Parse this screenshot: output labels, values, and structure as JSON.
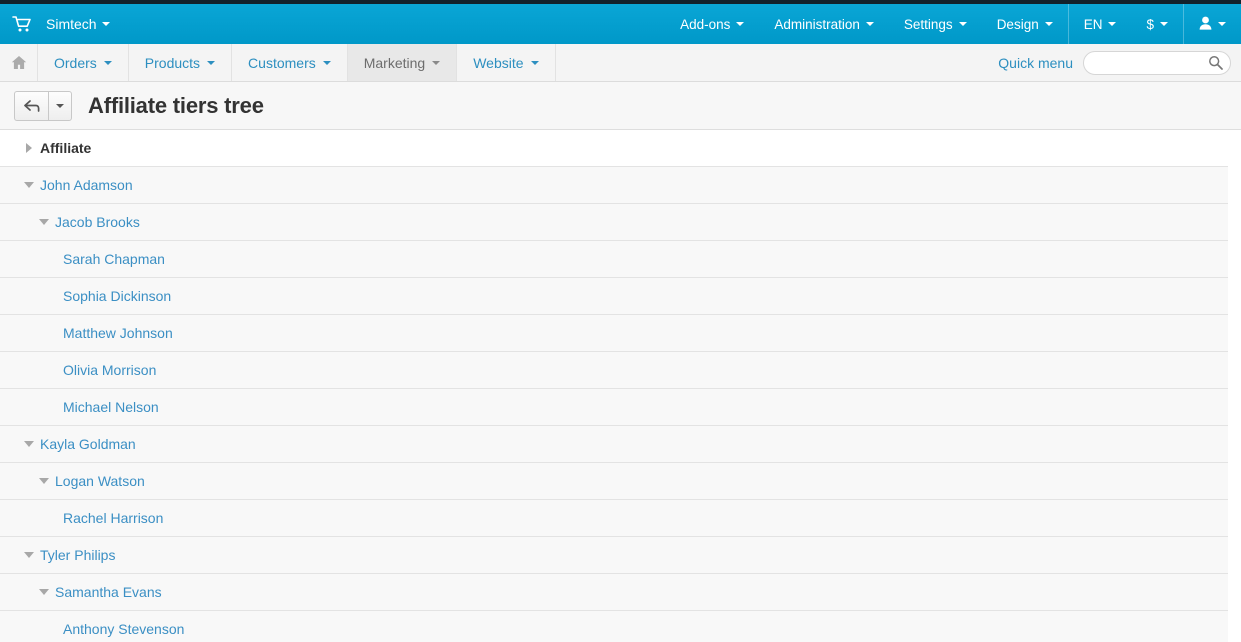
{
  "header": {
    "logo_icon": "cart-icon",
    "brand": "Simtech",
    "nav": [
      {
        "label": "Add-ons",
        "caret": true,
        "sep": false
      },
      {
        "label": "Administration",
        "caret": true,
        "sep": false
      },
      {
        "label": "Settings",
        "caret": true,
        "sep": false
      },
      {
        "label": "Design",
        "caret": true,
        "sep": false
      },
      {
        "label": "EN",
        "caret": true,
        "sep": true
      },
      {
        "label": "$",
        "caret": true,
        "sep": false
      }
    ],
    "user_icon": "user-icon"
  },
  "subnav": {
    "home_icon": "home-icon",
    "items": [
      {
        "label": "Orders",
        "active": false
      },
      {
        "label": "Products",
        "active": false
      },
      {
        "label": "Customers",
        "active": false
      },
      {
        "label": "Marketing",
        "active": true
      },
      {
        "label": "Website",
        "active": false
      }
    ],
    "quick_menu": "Quick menu",
    "search_value": "",
    "search_placeholder": ""
  },
  "titlebar": {
    "back_icon": "arrow-left-icon",
    "title": "Affiliate tiers tree"
  },
  "tree": {
    "rows": [
      {
        "label": "Affiliate",
        "level": 0,
        "toggle": "right",
        "header": true
      },
      {
        "label": "John Adamson",
        "level": 0,
        "toggle": "down",
        "header": false
      },
      {
        "label": "Jacob Brooks",
        "level": 1,
        "toggle": "down",
        "header": false
      },
      {
        "label": "Sarah Chapman",
        "level": 2,
        "toggle": "none",
        "header": false
      },
      {
        "label": "Sophia Dickinson",
        "level": 2,
        "toggle": "none",
        "header": false
      },
      {
        "label": "Matthew Johnson",
        "level": 2,
        "toggle": "none",
        "header": false
      },
      {
        "label": "Olivia Morrison",
        "level": 2,
        "toggle": "none",
        "header": false
      },
      {
        "label": "Michael Nelson",
        "level": 2,
        "toggle": "none",
        "header": false
      },
      {
        "label": "Kayla Goldman",
        "level": 0,
        "toggle": "down",
        "header": false
      },
      {
        "label": "Logan Watson",
        "level": 1,
        "toggle": "down",
        "header": false
      },
      {
        "label": "Rachel Harrison",
        "level": 2,
        "toggle": "none",
        "header": false
      },
      {
        "label": "Tyler Philips",
        "level": 0,
        "toggle": "down",
        "header": false
      },
      {
        "label": "Samantha Evans",
        "level": 1,
        "toggle": "down",
        "header": false
      },
      {
        "label": "Anthony Stevenson",
        "level": 2,
        "toggle": "none",
        "header": false
      }
    ]
  },
  "colors": {
    "brand_cyan": "#0aa6d6",
    "link_blue": "#3b8fc4",
    "row_gray": "#f8f8f8",
    "top_strip": "#12222c"
  }
}
